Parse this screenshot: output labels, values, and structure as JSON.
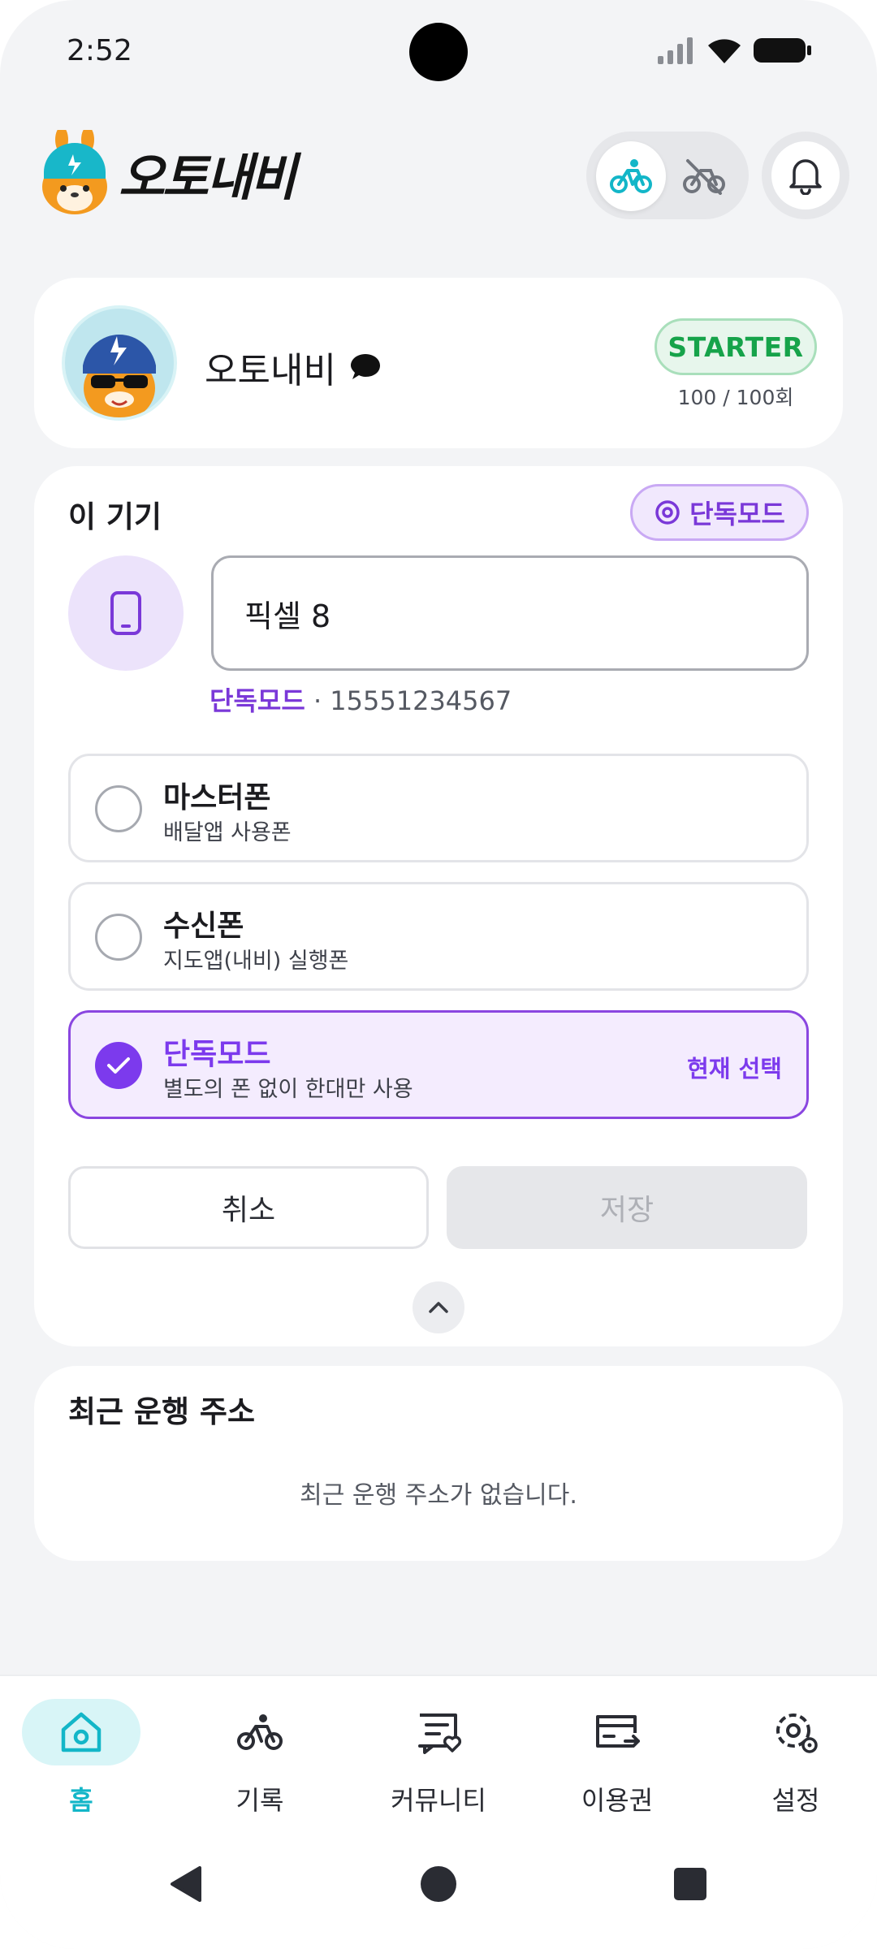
{
  "status_bar": {
    "time": "2:52"
  },
  "header": {
    "app_name": "오토내비",
    "mode_toggle": {
      "active_icon": "bike-icon",
      "inactive_icon": "bike-off-icon"
    },
    "notifications_icon": "bell-icon"
  },
  "profile": {
    "name": "오토내비",
    "chat_icon": "chat-bubble-icon",
    "plan": "STARTER",
    "usage": "100 / 100회"
  },
  "device": {
    "section_title": "이 기기",
    "mode_chip": "단독모드",
    "name_value": "픽셀 8",
    "meta_mode": "단독모드",
    "meta_separator": " · ",
    "meta_phone": "15551234567",
    "options": [
      {
        "title": "마스터폰",
        "subtitle": "배달앱 사용폰",
        "selected": false,
        "current_label": ""
      },
      {
        "title": "수신폰",
        "subtitle": "지도앱(내비) 실행폰",
        "selected": false,
        "current_label": ""
      },
      {
        "title": "단독모드",
        "subtitle": "별도의 폰 없이 한대만 사용",
        "selected": true,
        "current_label": "현재 선택"
      }
    ],
    "cancel_label": "취소",
    "save_label": "저장"
  },
  "recent": {
    "title": "최근 운행 주소",
    "empty_message": "최근 운행 주소가 없습니다."
  },
  "bottom_nav": [
    {
      "label": "홈",
      "icon": "home-icon",
      "active": true
    },
    {
      "label": "기록",
      "icon": "bike-icon",
      "active": false
    },
    {
      "label": "커뮤니티",
      "icon": "community-icon",
      "active": false
    },
    {
      "label": "이용권",
      "icon": "ticket-icon",
      "active": false
    },
    {
      "label": "설정",
      "icon": "settings-icon",
      "active": false
    }
  ],
  "colors": {
    "accent_teal": "#13b6c8",
    "accent_purple": "#7c3aed",
    "plan_green": "#16a34a",
    "background": "#f3f4f6"
  }
}
